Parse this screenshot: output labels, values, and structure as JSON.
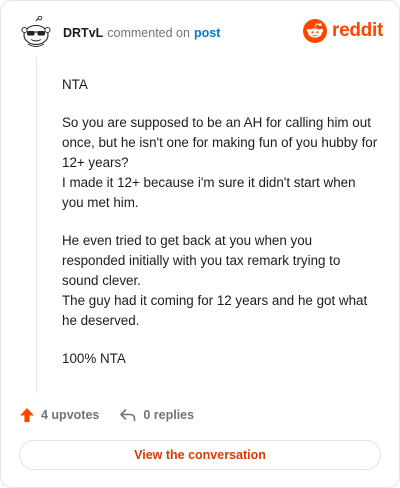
{
  "header": {
    "username": "DRTvL",
    "verb": "commented on",
    "post_link": "post",
    "brand": "reddit"
  },
  "comment": {
    "paragraphs": [
      "NTA",
      "So you are supposed to be an AH for calling him out once, but he isn't one for making fun of you hubby for 12+ years?\nI made it 12+ because i'm sure it didn't start when you met him.",
      "He even tried to get back at you when you responded initially with you tax remark trying to sound clever.\nThe guy had it coming for 12 years and he got what he deserved.",
      "100% NTA"
    ]
  },
  "actions": {
    "upvotes": "4 upvotes",
    "replies": "0 replies"
  },
  "footer": {
    "view_label": "View the conversation"
  },
  "colors": {
    "brand": "#ff4500",
    "link": "#0079d3",
    "button_text": "#d93a00",
    "upvote": "#ff4500"
  }
}
